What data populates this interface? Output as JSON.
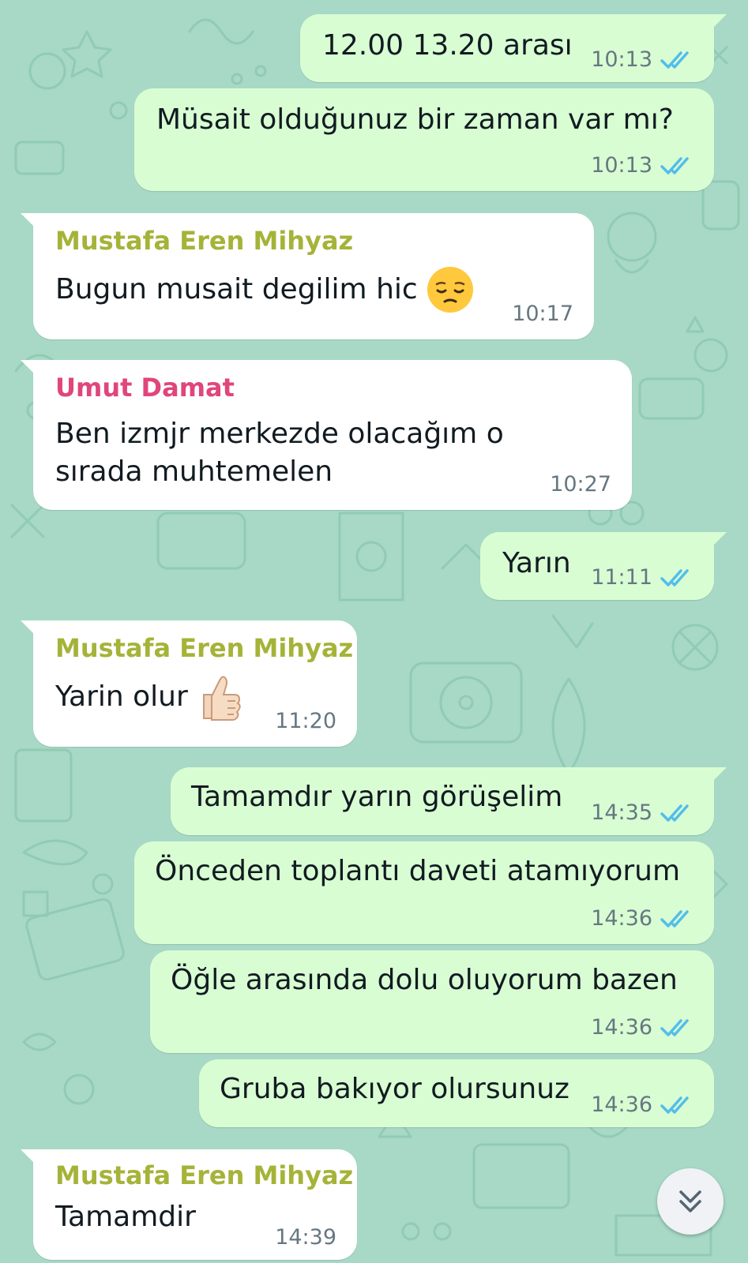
{
  "colors": {
    "background": "#a7d9c6",
    "outgoing_bubble": "#d9fdd3",
    "incoming_bubble": "#ffffff",
    "read_ticks": "#53bdeb",
    "timestamp": "#667781",
    "sender_mustafa": "#a5b338",
    "sender_umut": "#e0457b"
  },
  "messages": [
    {
      "direction": "outgoing",
      "text": "12.00 13.20 arası",
      "time": "10:13",
      "status_icon": "double-check-read-icon"
    },
    {
      "direction": "outgoing",
      "text": "Müsait olduğunuz bir zaman var mı?",
      "time": "10:13",
      "status_icon": "double-check-read-icon"
    },
    {
      "direction": "incoming",
      "sender": "Mustafa Eren Mihyaz",
      "text": "Bugun musait degilim hic",
      "emoji": "pensive-face-emoji",
      "time": "10:17"
    },
    {
      "direction": "incoming",
      "sender": "Umut Damat",
      "text_lines": [
        "Ben izmjr merkezde olacağım o",
        "sırada muhtemelen"
      ],
      "time": "10:27"
    },
    {
      "direction": "outgoing",
      "text": "Yarın",
      "time": "11:11",
      "status_icon": "double-check-read-icon"
    },
    {
      "direction": "incoming",
      "sender": "Mustafa Eren Mihyaz",
      "text": "Yarin olur",
      "emoji": "thumbs-up-emoji",
      "time": "11:20"
    },
    {
      "direction": "outgoing",
      "text": "Tamamdır yarın görüşelim",
      "time": "14:35",
      "status_icon": "double-check-read-icon"
    },
    {
      "direction": "outgoing",
      "text": "Önceden toplantı daveti atamıyorum",
      "time": "14:36",
      "status_icon": "double-check-read-icon"
    },
    {
      "direction": "outgoing",
      "text": "Öğle arasında dolu oluyorum bazen",
      "time": "14:36",
      "status_icon": "double-check-read-icon"
    },
    {
      "direction": "outgoing",
      "text": "Gruba bakıyor olursunuz",
      "time": "14:36",
      "status_icon": "double-check-read-icon"
    },
    {
      "direction": "incoming",
      "sender": "Mustafa Eren Mihyaz",
      "text": "Tamamdir",
      "time": "14:39"
    }
  ],
  "scroll_button": {
    "icon": "double-chevron-down-icon"
  }
}
